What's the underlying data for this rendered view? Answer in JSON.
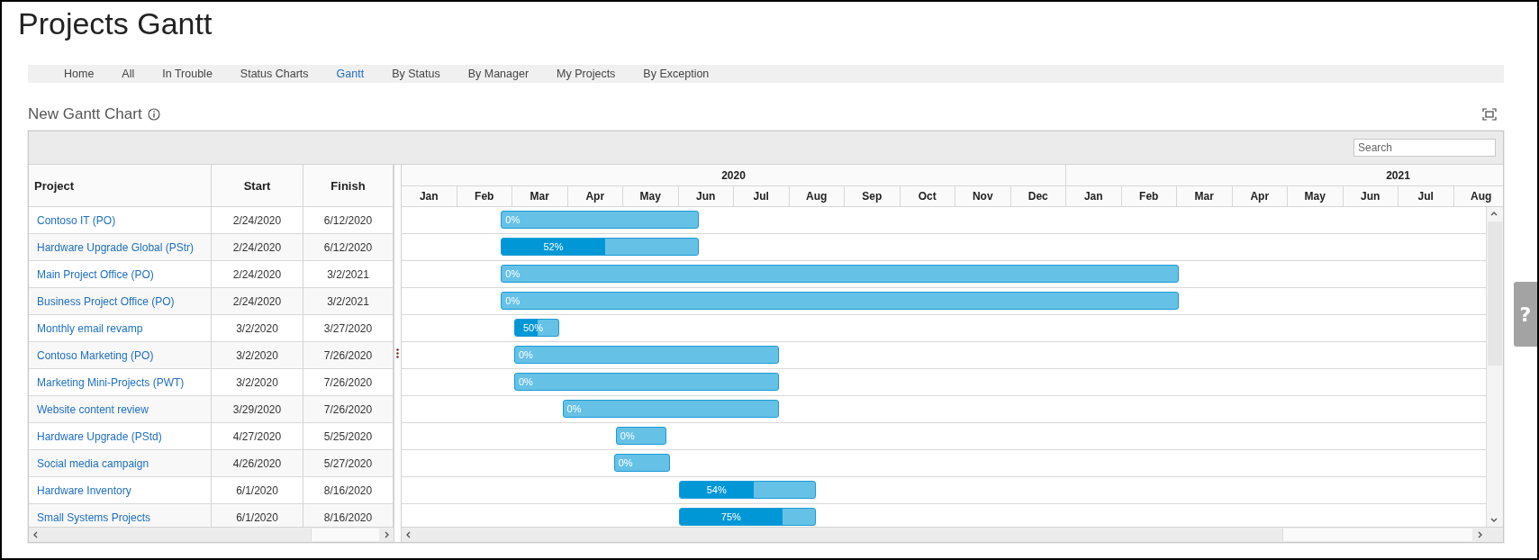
{
  "page_title": "Projects Gantt",
  "help_button": "?",
  "nav": [
    {
      "label": "Home",
      "selected": false
    },
    {
      "label": "All",
      "selected": false
    },
    {
      "label": "In Trouble",
      "selected": false
    },
    {
      "label": "Status Charts",
      "selected": false
    },
    {
      "label": "Gantt",
      "selected": true
    },
    {
      "label": "By Status",
      "selected": false
    },
    {
      "label": "By Manager",
      "selected": false
    },
    {
      "label": "My Projects",
      "selected": false
    },
    {
      "label": "By Exception",
      "selected": false
    }
  ],
  "section": {
    "title": "New Gantt Chart"
  },
  "search": {
    "placeholder": "Search"
  },
  "columns": [
    "Project",
    "Start",
    "Finish"
  ],
  "timeline": [
    {
      "year": "2020",
      "months": [
        "Jan",
        "Feb",
        "Mar",
        "Apr",
        "May",
        "Jun",
        "Jul",
        "Aug",
        "Sep",
        "Oct",
        "Nov",
        "Dec"
      ]
    },
    {
      "year": "2021",
      "months": [
        "Jan",
        "Feb",
        "Mar",
        "Apr",
        "May",
        "Jun",
        "Jul",
        "Aug"
      ]
    }
  ],
  "rows": [
    {
      "project": "Contoso IT (PO)",
      "start": "2/24/2020",
      "finish": "6/12/2020",
      "progress": "0%"
    },
    {
      "project": "Hardware Upgrade Global (PStr)",
      "start": "2/24/2020",
      "finish": "6/12/2020",
      "progress": "52%",
      "level": 0.52
    },
    {
      "project": "Main Project Office (PO)",
      "start": "2/24/2020",
      "finish": "3/2/2021",
      "progress": "0%"
    },
    {
      "project": "Business Project Office (PO)",
      "start": "2/24/2020",
      "finish": "3/2/2021",
      "progress": "0%"
    },
    {
      "project": "Monthly email revamp",
      "start": "3/2/2020",
      "finish": "3/27/2020",
      "progress": "50%",
      "level": 0.5
    },
    {
      "project": "Contoso Marketing (PO)",
      "start": "3/2/2020",
      "finish": "7/26/2020",
      "progress": "0%"
    },
    {
      "project": "Marketing Mini-Projects (PWT)",
      "start": "3/2/2020",
      "finish": "7/26/2020",
      "progress": "0%"
    },
    {
      "project": "Website content review",
      "start": "3/29/2020",
      "finish": "7/26/2020",
      "progress": "0%"
    },
    {
      "project": "Hardware Upgrade (PStd)",
      "start": "4/27/2020",
      "finish": "5/25/2020",
      "progress": "0%"
    },
    {
      "project": "Social media campaign",
      "start": "4/26/2020",
      "finish": "5/27/2020",
      "progress": "0%"
    },
    {
      "project": "Hardware Inventory",
      "start": "6/1/2020",
      "finish": "8/16/2020",
      "progress": "54%",
      "level": 0.54
    },
    {
      "project": "Small Systems Projects",
      "start": "6/1/2020",
      "finish": "8/16/2020",
      "progress": "75%",
      "level": 0.75
    }
  ]
}
